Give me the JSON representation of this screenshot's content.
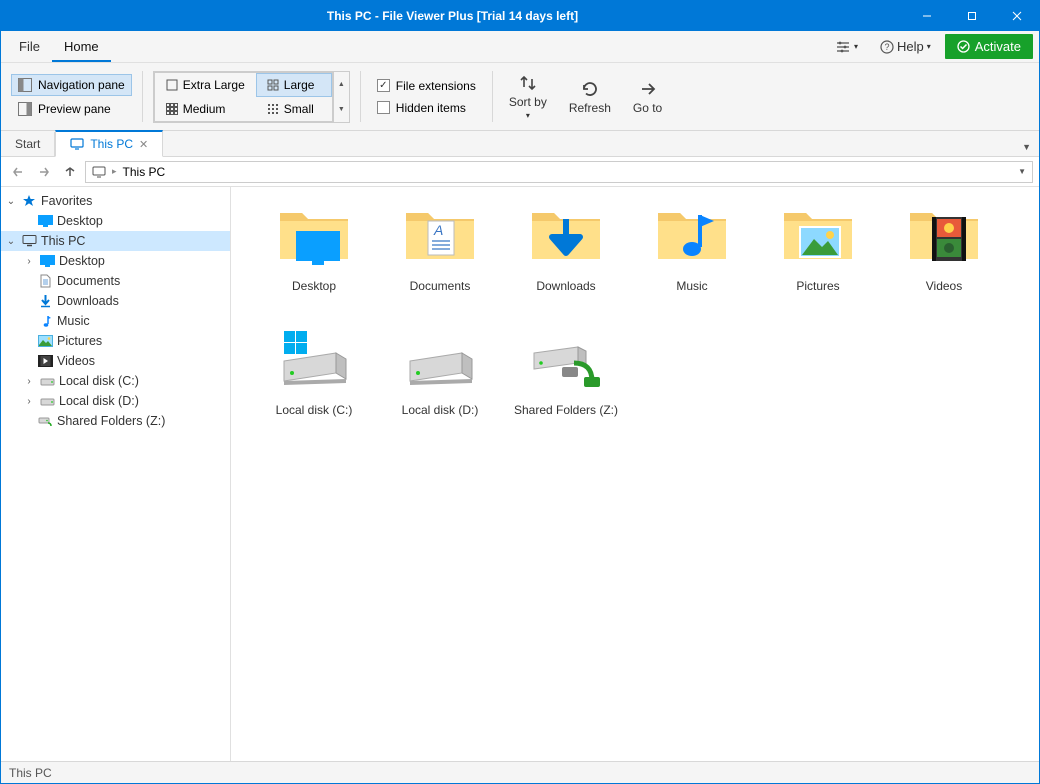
{
  "title": "This PC - File Viewer Plus [Trial 14 days left]",
  "menu": {
    "file": "File",
    "home": "Home",
    "help": "Help",
    "activate": "Activate"
  },
  "ribbon": {
    "navigation_pane": "Navigation pane",
    "preview_pane": "Preview pane",
    "extra_large": "Extra Large",
    "large": "Large",
    "medium": "Medium",
    "small": "Small",
    "file_extensions": "File extensions",
    "hidden_items": "Hidden items",
    "sort_by": "Sort by",
    "refresh": "Refresh",
    "go_to": "Go to"
  },
  "tabs": {
    "start": "Start",
    "this_pc": "This PC"
  },
  "address": {
    "location": "This PC"
  },
  "sidebar": {
    "favorites": "Favorites",
    "desktop": "Desktop",
    "this_pc": "This PC",
    "documents": "Documents",
    "downloads": "Downloads",
    "music": "Music",
    "pictures": "Pictures",
    "videos": "Videos",
    "local_c": "Local disk (C:)",
    "local_d": "Local disk (D:)",
    "shared_z": "Shared Folders (Z:)"
  },
  "grid": {
    "desktop": "Desktop",
    "documents": "Documents",
    "downloads": "Downloads",
    "music": "Music",
    "pictures": "Pictures",
    "videos": "Videos",
    "local_c": "Local disk (C:)",
    "local_d": "Local disk (D:)",
    "shared_z": "Shared Folders (Z:)"
  },
  "status": {
    "text": "This PC"
  }
}
